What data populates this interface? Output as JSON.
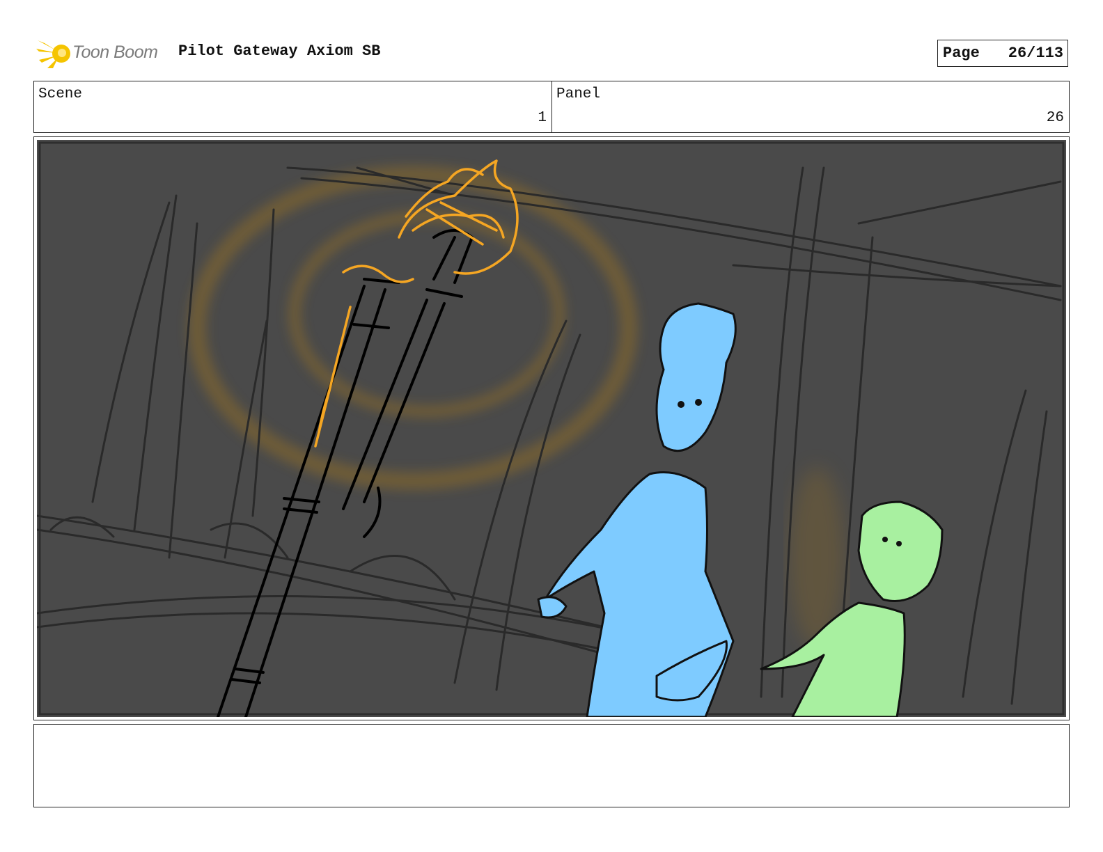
{
  "header": {
    "logo_text": "Toon Boom",
    "title": "Pilot Gateway Axiom SB",
    "page_label": "Page",
    "page_value": "26/113"
  },
  "info": {
    "scene_label": "Scene",
    "scene_value": "1",
    "panel_label": "Panel",
    "panel_value": "26"
  },
  "panel_image": {
    "icon": "storyboard-sketch",
    "background_color": "#4a4a4a",
    "accent_colors": {
      "torch_fire": "#f5a623",
      "tall_character": "#7ecbff",
      "small_character": "#a8f0a0"
    }
  },
  "notes": {
    "text": ""
  },
  "colors": {
    "logo_accent": "#f5c400",
    "border": "#222222"
  }
}
